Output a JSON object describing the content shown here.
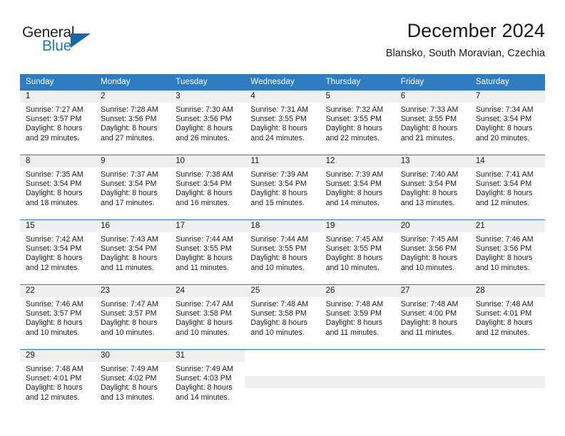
{
  "brand": {
    "name_top": "General",
    "name_bottom": "Blue",
    "accent_color": "#1168ab",
    "text_color": "#1d7ec4"
  },
  "header": {
    "title": "December 2024",
    "subtitle": "Blansko, South Moravian, Czechia"
  },
  "theme": {
    "header_bg": "#2f7dc0",
    "header_text": "#ffffff",
    "daynumber_bg": "#efefef",
    "grid_line": "#2f7dc0"
  },
  "weekday_headers": [
    "Sunday",
    "Monday",
    "Tuesday",
    "Wednesday",
    "Thursday",
    "Friday",
    "Saturday"
  ],
  "labels": {
    "sunrise_prefix": "Sunrise:",
    "sunset_prefix": "Sunset:",
    "daylight_prefix": "Daylight:"
  },
  "weeks": [
    [
      {
        "day": "1",
        "sunrise": "Sunrise: 7:27 AM",
        "sunset": "Sunset: 3:57 PM",
        "daylight1": "Daylight: 8 hours",
        "daylight2": "and 29 minutes."
      },
      {
        "day": "2",
        "sunrise": "Sunrise: 7:28 AM",
        "sunset": "Sunset: 3:56 PM",
        "daylight1": "Daylight: 8 hours",
        "daylight2": "and 27 minutes."
      },
      {
        "day": "3",
        "sunrise": "Sunrise: 7:30 AM",
        "sunset": "Sunset: 3:56 PM",
        "daylight1": "Daylight: 8 hours",
        "daylight2": "and 26 minutes."
      },
      {
        "day": "4",
        "sunrise": "Sunrise: 7:31 AM",
        "sunset": "Sunset: 3:55 PM",
        "daylight1": "Daylight: 8 hours",
        "daylight2": "and 24 minutes."
      },
      {
        "day": "5",
        "sunrise": "Sunrise: 7:32 AM",
        "sunset": "Sunset: 3:55 PM",
        "daylight1": "Daylight: 8 hours",
        "daylight2": "and 22 minutes."
      },
      {
        "day": "6",
        "sunrise": "Sunrise: 7:33 AM",
        "sunset": "Sunset: 3:55 PM",
        "daylight1": "Daylight: 8 hours",
        "daylight2": "and 21 minutes."
      },
      {
        "day": "7",
        "sunrise": "Sunrise: 7:34 AM",
        "sunset": "Sunset: 3:54 PM",
        "daylight1": "Daylight: 8 hours",
        "daylight2": "and 20 minutes."
      }
    ],
    [
      {
        "day": "8",
        "sunrise": "Sunrise: 7:35 AM",
        "sunset": "Sunset: 3:54 PM",
        "daylight1": "Daylight: 8 hours",
        "daylight2": "and 18 minutes."
      },
      {
        "day": "9",
        "sunrise": "Sunrise: 7:37 AM",
        "sunset": "Sunset: 3:54 PM",
        "daylight1": "Daylight: 8 hours",
        "daylight2": "and 17 minutes."
      },
      {
        "day": "10",
        "sunrise": "Sunrise: 7:38 AM",
        "sunset": "Sunset: 3:54 PM",
        "daylight1": "Daylight: 8 hours",
        "daylight2": "and 16 minutes."
      },
      {
        "day": "11",
        "sunrise": "Sunrise: 7:39 AM",
        "sunset": "Sunset: 3:54 PM",
        "daylight1": "Daylight: 8 hours",
        "daylight2": "and 15 minutes."
      },
      {
        "day": "12",
        "sunrise": "Sunrise: 7:39 AM",
        "sunset": "Sunset: 3:54 PM",
        "daylight1": "Daylight: 8 hours",
        "daylight2": "and 14 minutes."
      },
      {
        "day": "13",
        "sunrise": "Sunrise: 7:40 AM",
        "sunset": "Sunset: 3:54 PM",
        "daylight1": "Daylight: 8 hours",
        "daylight2": "and 13 minutes."
      },
      {
        "day": "14",
        "sunrise": "Sunrise: 7:41 AM",
        "sunset": "Sunset: 3:54 PM",
        "daylight1": "Daylight: 8 hours",
        "daylight2": "and 12 minutes."
      }
    ],
    [
      {
        "day": "15",
        "sunrise": "Sunrise: 7:42 AM",
        "sunset": "Sunset: 3:54 PM",
        "daylight1": "Daylight: 8 hours",
        "daylight2": "and 12 minutes."
      },
      {
        "day": "16",
        "sunrise": "Sunrise: 7:43 AM",
        "sunset": "Sunset: 3:54 PM",
        "daylight1": "Daylight: 8 hours",
        "daylight2": "and 11 minutes."
      },
      {
        "day": "17",
        "sunrise": "Sunrise: 7:44 AM",
        "sunset": "Sunset: 3:55 PM",
        "daylight1": "Daylight: 8 hours",
        "daylight2": "and 11 minutes."
      },
      {
        "day": "18",
        "sunrise": "Sunrise: 7:44 AM",
        "sunset": "Sunset: 3:55 PM",
        "daylight1": "Daylight: 8 hours",
        "daylight2": "and 10 minutes."
      },
      {
        "day": "19",
        "sunrise": "Sunrise: 7:45 AM",
        "sunset": "Sunset: 3:55 PM",
        "daylight1": "Daylight: 8 hours",
        "daylight2": "and 10 minutes."
      },
      {
        "day": "20",
        "sunrise": "Sunrise: 7:45 AM",
        "sunset": "Sunset: 3:56 PM",
        "daylight1": "Daylight: 8 hours",
        "daylight2": "and 10 minutes."
      },
      {
        "day": "21",
        "sunrise": "Sunrise: 7:46 AM",
        "sunset": "Sunset: 3:56 PM",
        "daylight1": "Daylight: 8 hours",
        "daylight2": "and 10 minutes."
      }
    ],
    [
      {
        "day": "22",
        "sunrise": "Sunrise: 7:46 AM",
        "sunset": "Sunset: 3:57 PM",
        "daylight1": "Daylight: 8 hours",
        "daylight2": "and 10 minutes."
      },
      {
        "day": "23",
        "sunrise": "Sunrise: 7:47 AM",
        "sunset": "Sunset: 3:57 PM",
        "daylight1": "Daylight: 8 hours",
        "daylight2": "and 10 minutes."
      },
      {
        "day": "24",
        "sunrise": "Sunrise: 7:47 AM",
        "sunset": "Sunset: 3:58 PM",
        "daylight1": "Daylight: 8 hours",
        "daylight2": "and 10 minutes."
      },
      {
        "day": "25",
        "sunrise": "Sunrise: 7:48 AM",
        "sunset": "Sunset: 3:58 PM",
        "daylight1": "Daylight: 8 hours",
        "daylight2": "and 10 minutes."
      },
      {
        "day": "26",
        "sunrise": "Sunrise: 7:48 AM",
        "sunset": "Sunset: 3:59 PM",
        "daylight1": "Daylight: 8 hours",
        "daylight2": "and 11 minutes."
      },
      {
        "day": "27",
        "sunrise": "Sunrise: 7:48 AM",
        "sunset": "Sunset: 4:00 PM",
        "daylight1": "Daylight: 8 hours",
        "daylight2": "and 11 minutes."
      },
      {
        "day": "28",
        "sunrise": "Sunrise: 7:48 AM",
        "sunset": "Sunset: 4:01 PM",
        "daylight1": "Daylight: 8 hours",
        "daylight2": "and 12 minutes."
      }
    ],
    [
      {
        "day": "29",
        "sunrise": "Sunrise: 7:48 AM",
        "sunset": "Sunset: 4:01 PM",
        "daylight1": "Daylight: 8 hours",
        "daylight2": "and 12 minutes."
      },
      {
        "day": "30",
        "sunrise": "Sunrise: 7:49 AM",
        "sunset": "Sunset: 4:02 PM",
        "daylight1": "Daylight: 8 hours",
        "daylight2": "and 13 minutes."
      },
      {
        "day": "31",
        "sunrise": "Sunrise: 7:49 AM",
        "sunset": "Sunset: 4:03 PM",
        "daylight1": "Daylight: 8 hours",
        "daylight2": "and 14 minutes."
      },
      null,
      null,
      null,
      null
    ]
  ]
}
